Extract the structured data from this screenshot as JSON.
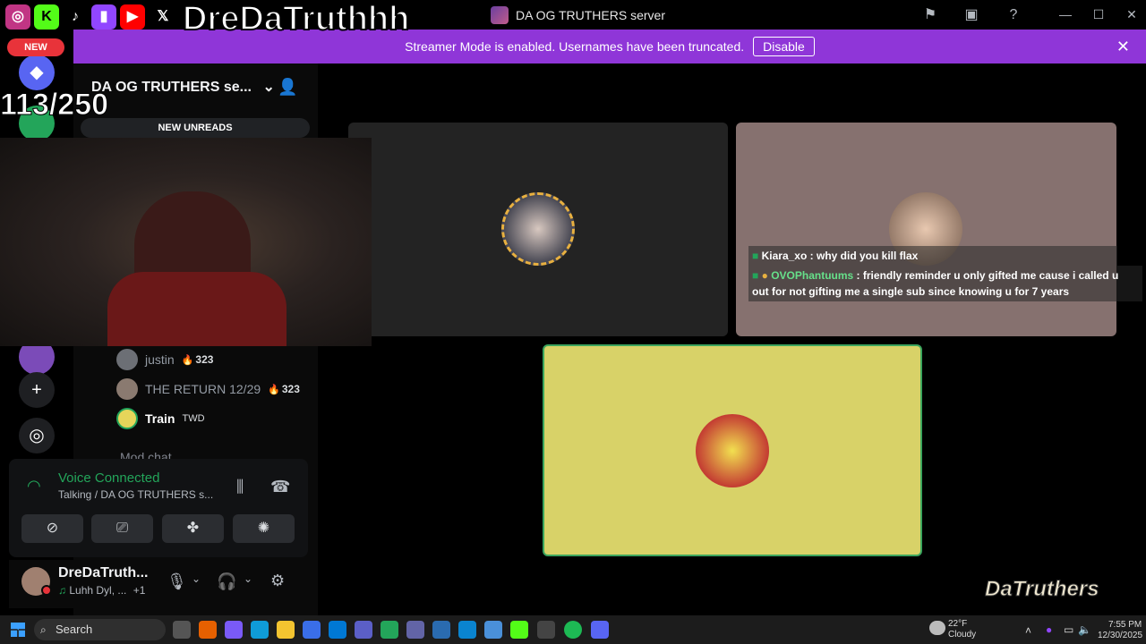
{
  "window": {
    "title": "DA OG TRUTHERS server",
    "minimize": "—",
    "maximize": "☐",
    "close": "✕"
  },
  "banner": {
    "message": "Streamer Mode is enabled. Usernames have been truncated.",
    "disable_label": "Disable"
  },
  "rail": {
    "new_badge": "NEW"
  },
  "sidebar": {
    "server_name": "DA OG TRUTHERS se...",
    "new_unreads": "NEW UNREADS",
    "members": [
      {
        "name": "justin",
        "badge": "323"
      },
      {
        "name": "THE RETURN 12/29",
        "badge": "323"
      },
      {
        "name": "Train",
        "tag": "TWD"
      }
    ],
    "partial_channel": "Mod chat"
  },
  "voice": {
    "status": "Voice Connected",
    "channel": "Talking / DA OG TRUTHERS s..."
  },
  "user": {
    "name": "DreDaTruth...",
    "activity": "Luhh Dyl, ...",
    "extra": "+1"
  },
  "chat": [
    {
      "user": "Kiara_xo",
      "text": "why did you kill flax"
    },
    {
      "user": "OVOPhantuums",
      "text": "friendly reminder u only gifted me cause i called u",
      "text2": "out for not gifting me a single sub since knowing u for 7 years"
    }
  ],
  "overlay": {
    "streamer_name": "DreDaTruthhh",
    "sub_count": "113/250",
    "watermark": "DaTruthers"
  },
  "taskbar": {
    "search": "Search",
    "weather_temp": "22°F",
    "weather_desc": "Cloudy",
    "time": "7:55 PM",
    "date": "12/30/2025"
  },
  "colors": {
    "banner": "#8f36d8",
    "voice_green": "#23a55a",
    "speaking_border": "#3ba55d",
    "new_badge": "#e8333a"
  }
}
